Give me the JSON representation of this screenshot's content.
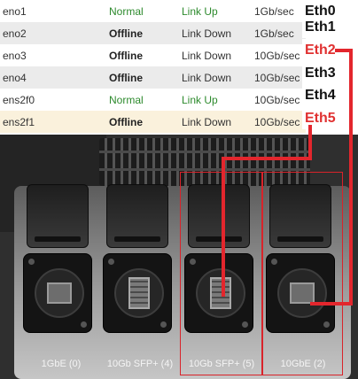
{
  "interfaces": [
    {
      "name": "eno1",
      "status": "Normal",
      "link": "Link Up",
      "speed": "1Gb/sec",
      "eth": "Eth0"
    },
    {
      "name": "eno2",
      "status": "Offline",
      "link": "Link Down",
      "speed": "1Gb/sec",
      "eth": "Eth1"
    },
    {
      "name": "eno3",
      "status": "Offline",
      "link": "Link Down",
      "speed": "10Gb/sec",
      "eth": "Eth2"
    },
    {
      "name": "eno4",
      "status": "Offline",
      "link": "Link Down",
      "speed": "10Gb/sec",
      "eth": "Eth3"
    },
    {
      "name": "ens2f0",
      "status": "Normal",
      "link": "Link Up",
      "speed": "10Gb/sec",
      "eth": "Eth4"
    },
    {
      "name": "ens2f1",
      "status": "Offline",
      "link": "Link Down",
      "speed": "10Gb/sec",
      "eth": "Eth5"
    }
  ],
  "ports": [
    {
      "label": "1GbE (0)",
      "type": "rj45"
    },
    {
      "label": "10Gb SFP+ (4)",
      "type": "sfp"
    },
    {
      "label": "10Gb SFP+ (5)",
      "type": "sfp"
    },
    {
      "label": "10GbE (2)",
      "type": "rj45"
    }
  ],
  "colors": {
    "annotation_red": "#e3262d",
    "status_normal": "#2d8a2d",
    "highlight_row": "#faf1dc"
  }
}
